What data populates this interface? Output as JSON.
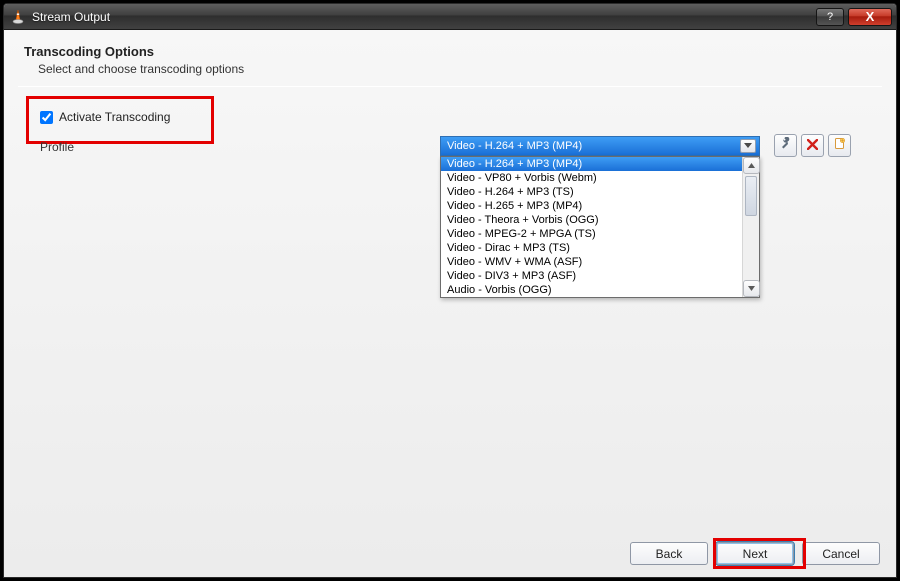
{
  "window": {
    "title": "Stream Output",
    "help_label": "?",
    "close_label": "X"
  },
  "page": {
    "heading": "Transcoding Options",
    "subheading": "Select and choose transcoding options"
  },
  "activate": {
    "label": "Activate Transcoding",
    "checked": true
  },
  "profile": {
    "label": "Profile",
    "selected": "Video - H.264 + MP3 (MP4)",
    "options": [
      "Video - H.264 + MP3 (MP4)",
      "Video - VP80 + Vorbis (Webm)",
      "Video - H.264 + MP3 (TS)",
      "Video - H.265 + MP3 (MP4)",
      "Video - Theora + Vorbis (OGG)",
      "Video - MPEG-2 + MPGA (TS)",
      "Video - Dirac + MP3 (TS)",
      "Video - WMV + WMA (ASF)",
      "Video - DIV3 + MP3 (ASF)",
      "Audio - Vorbis (OGG)"
    ],
    "highlighted_index": 0
  },
  "icon_buttons": {
    "edit_tooltip": "Edit selected profile",
    "delete_tooltip": "Delete selected profile",
    "new_tooltip": "Create a new profile"
  },
  "buttons": {
    "back": "Back",
    "next": "Next",
    "cancel": "Cancel"
  },
  "colors": {
    "highlight_red": "#e30000",
    "selection_blue": "#1a6fd6"
  }
}
